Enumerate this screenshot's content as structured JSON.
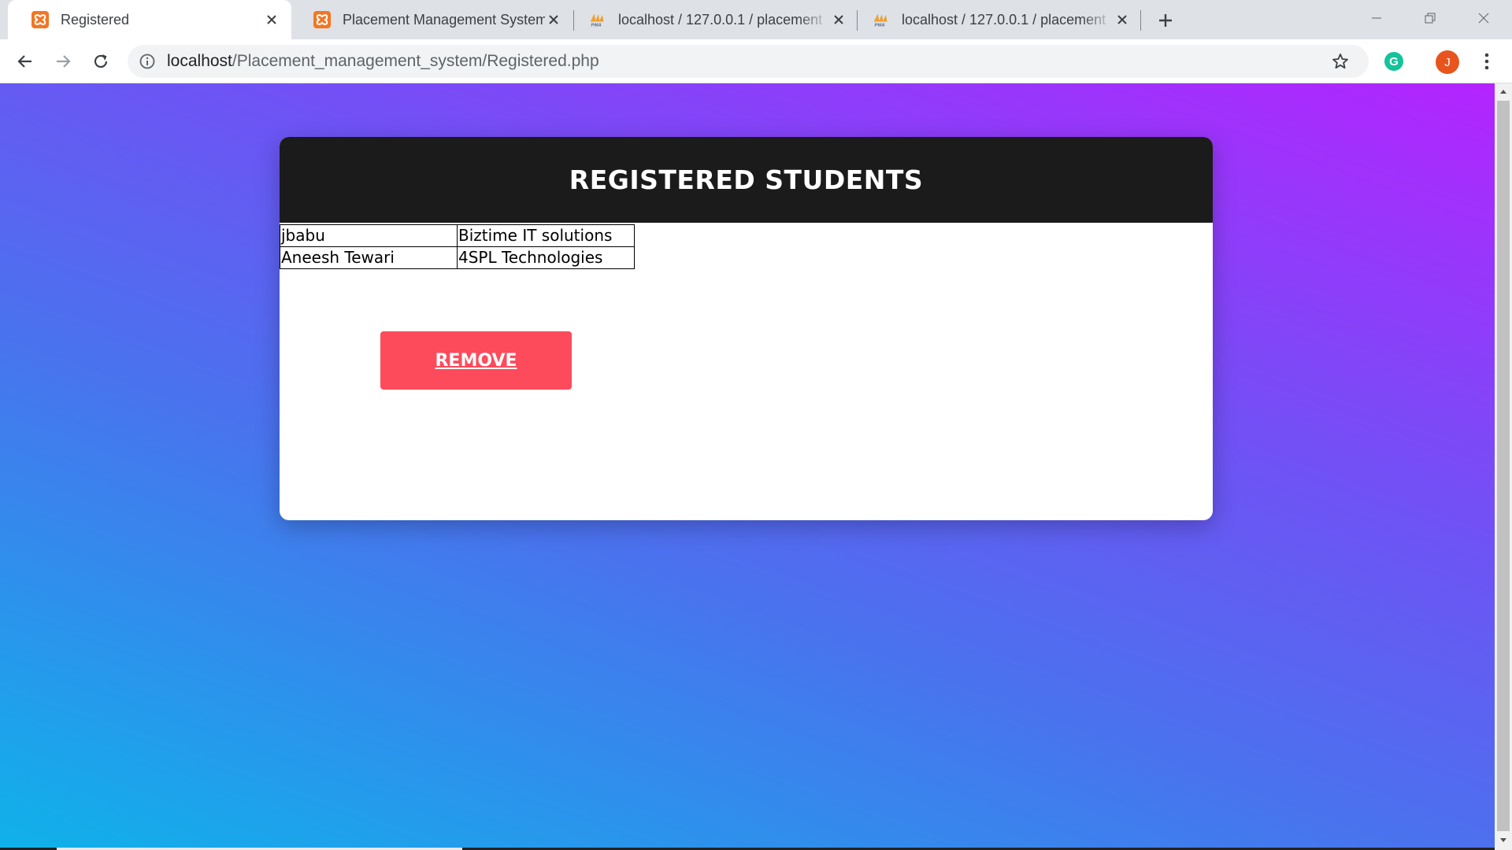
{
  "browser": {
    "tabs": [
      {
        "title": "Registered",
        "favicon": "xampp-icon",
        "active": true
      },
      {
        "title": "Placement Management System",
        "favicon": "xampp-icon",
        "active": false
      },
      {
        "title": "localhost / 127.0.0.1 / placement",
        "favicon": "phpmyadmin-icon",
        "active": false
      },
      {
        "title": "localhost / 127.0.0.1 / placement",
        "favicon": "phpmyadmin-icon",
        "active": false
      }
    ],
    "url_host": "localhost",
    "url_path": "/Placement_management_system/Registered.php",
    "profile_initial": "J",
    "extension_initial": "G",
    "colors": {
      "tab_strip": "#dee1e6",
      "xampp_orange": "#f37623",
      "profile": "#e8541e",
      "grammarly": "#15c39a"
    }
  },
  "page": {
    "heading": "REGISTERED STUDENTS",
    "rows": [
      [
        "jbabu",
        "Biztime IT solutions"
      ],
      [
        "Aneesh Tewari",
        "4SPL Technologies"
      ]
    ],
    "remove_label": "REMOVE",
    "colors": {
      "header_bg": "#1b1b1b",
      "button_bg": "#fd4b5c",
      "gradient_top_right": "#b424ff",
      "gradient_bottom_left": "#0fb2ea"
    }
  }
}
